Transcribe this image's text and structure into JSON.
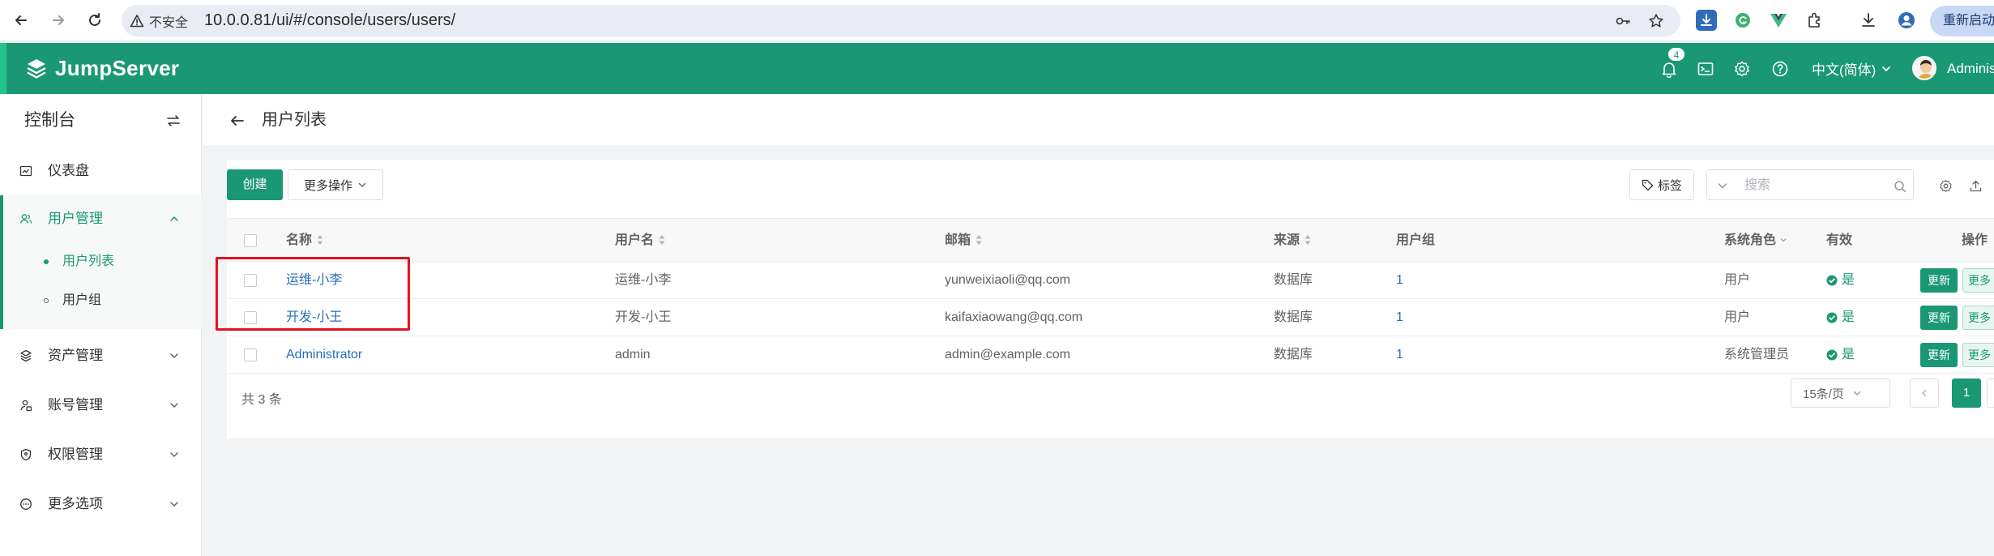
{
  "browser": {
    "security_label": "不安全",
    "url": "10.0.0.81/ui/#/console/users/users/",
    "relaunch_label": "重新启动"
  },
  "header": {
    "brand": "JumpServer",
    "notification_count": "4",
    "language": "中文(简体)",
    "username": "Administrator"
  },
  "sidebar": {
    "title": "控制台",
    "items": [
      {
        "label": "仪表盘",
        "icon": "dashboard-icon"
      },
      {
        "label": "用户管理",
        "icon": "users-icon",
        "expanded": true,
        "children": [
          {
            "label": "用户列表",
            "active": true
          },
          {
            "label": "用户组",
            "active": false
          }
        ]
      },
      {
        "label": "资产管理",
        "icon": "layers-icon"
      },
      {
        "label": "账号管理",
        "icon": "account-icon"
      },
      {
        "label": "权限管理",
        "icon": "shield-icon"
      },
      {
        "label": "更多选项",
        "icon": "more-circle-icon"
      }
    ]
  },
  "page": {
    "title": "用户列表"
  },
  "toolbar": {
    "create_label": "创建",
    "more_actions_label": "更多操作",
    "tags_label": "标签",
    "search_placeholder": "搜索"
  },
  "table": {
    "columns": [
      "名称",
      "用户名",
      "邮箱",
      "来源",
      "用户组",
      "系统角色",
      "有效",
      "操作"
    ],
    "rows": [
      {
        "name": "运维-小李",
        "username": "运维-小李",
        "email": "yunweixiaoli@qq.com",
        "source": "数据库",
        "groups": "1",
        "role": "用户",
        "active": "是"
      },
      {
        "name": "开发-小王",
        "username": "开发-小王",
        "email": "kaifaxiaowang@qq.com",
        "source": "数据库",
        "groups": "1",
        "role": "用户",
        "active": "是"
      },
      {
        "name": "Administrator",
        "username": "admin",
        "email": "admin@example.com",
        "source": "数据库",
        "groups": "1",
        "role": "系统管理员",
        "active": "是"
      }
    ],
    "update_label": "更新",
    "more_label": "更多"
  },
  "footer": {
    "total": "共 3 条",
    "page_size": "15条/页",
    "current_page": "1"
  },
  "colors": {
    "brand_green": "#1a9874",
    "link_blue": "#2a6fbb",
    "highlight_red": "#e0141e"
  }
}
